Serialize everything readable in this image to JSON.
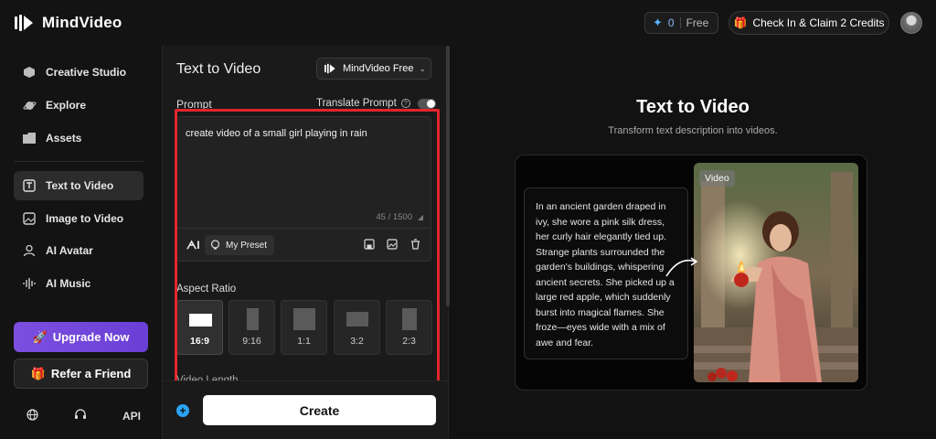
{
  "app": {
    "name": "MindVideo"
  },
  "topbar": {
    "credits_count": "0",
    "credits_plan": "Free",
    "checkin_label": "Check In & Claim 2 Credits"
  },
  "sidebar": {
    "items": [
      {
        "label": "Creative Studio",
        "icon": "cube-icon"
      },
      {
        "label": "Explore",
        "icon": "planet-icon"
      },
      {
        "label": "Assets",
        "icon": "folder-icon"
      },
      {
        "label": "Text to Video",
        "icon": "text-video-icon",
        "active": true
      },
      {
        "label": "Image to Video",
        "icon": "image-icon"
      },
      {
        "label": "AI Avatar",
        "icon": "avatar-icon"
      },
      {
        "label": "AI Music",
        "icon": "waveform-icon"
      }
    ],
    "upgrade_label": "Upgrade Now",
    "refer_label": "Refer a Friend",
    "api_label": "API"
  },
  "form": {
    "title": "Text to Video",
    "model": "MindVideo Free",
    "prompt_label": "Prompt",
    "translate_label": "Translate Prompt",
    "prompt_value": "create video of a small girl playing in rain",
    "char_count": "45 / 1500",
    "preset_label": "My Preset",
    "aspect_label": "Aspect Ratio",
    "ratios": [
      "16:9",
      "9:16",
      "1:1",
      "3:2",
      "2:3"
    ],
    "selected_ratio": "16:9",
    "video_length_label": "Video Length",
    "create_label": "Create"
  },
  "preview": {
    "title": "Text to Video",
    "subtitle": "Transform text description into videos.",
    "example_text": "In an ancient garden draped in ivy, she wore a pink silk dress, her curly hair elegantly tied up. Strange plants surrounded the garden's buildings, whispering ancient secrets. She picked up a large red apple, which suddenly burst into magical flames. She froze—eyes wide with a mix of awe and fear.",
    "video_badge": "Video"
  },
  "colors": {
    "accent_purple": "#7b4fe0",
    "highlight_red": "#e3262b",
    "plus_blue": "#2aa3f5"
  }
}
